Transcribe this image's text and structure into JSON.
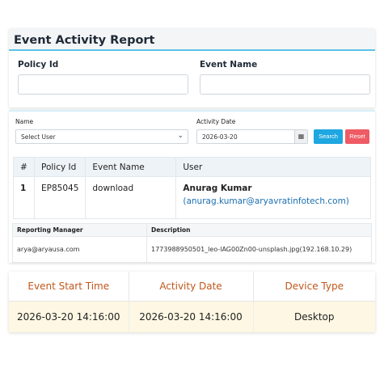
{
  "header": {
    "title": "Event Activity Report",
    "policy_id_label": "Policy Id",
    "event_name_label": "Event Name",
    "policy_id_value": "",
    "event_name_value": ""
  },
  "filters": {
    "name_label": "Name",
    "name_value": "Select User",
    "activity_date_label": "Activity Date",
    "activity_date_value": "2026-03-20",
    "search_label": "Search",
    "reset_label": "Reset"
  },
  "main_table": {
    "columns": [
      "#",
      "Policy Id",
      "Event Name",
      "User"
    ],
    "rows": [
      {
        "index": "1",
        "policy_id": "EP85045",
        "event_name": "download",
        "user_name": "Anurag Kumar",
        "user_email": "(anurag.kumar@aryavratinfotech.com)"
      }
    ]
  },
  "detail_table": {
    "columns": [
      "Reporting Manager",
      "Description"
    ],
    "rows": [
      {
        "reporting_manager": "arya@aryausa.com",
        "description": "1773988950501_leo-lAG00Zn00-unsplash.jpg(192.168.10.29)"
      }
    ]
  },
  "event_table": {
    "columns": [
      "Event Start Time",
      "Activity Date",
      "Device Type"
    ],
    "rows": [
      {
        "start_time": "2026-03-20 14:16:00",
        "activity_date": "2026-03-20 14:16:00",
        "device_type": "Desktop"
      }
    ]
  },
  "icons": {
    "calendar": "calendar-icon",
    "select_chevron": "chevron-down-icon"
  },
  "colors": {
    "accent": "#5bc3e8",
    "search_button": "#1ea7e0",
    "reset_button": "#ef5b65",
    "event_header_text": "#c0571a",
    "event_row_bg": "#fdf7e3",
    "link": "#1a6fb0"
  }
}
